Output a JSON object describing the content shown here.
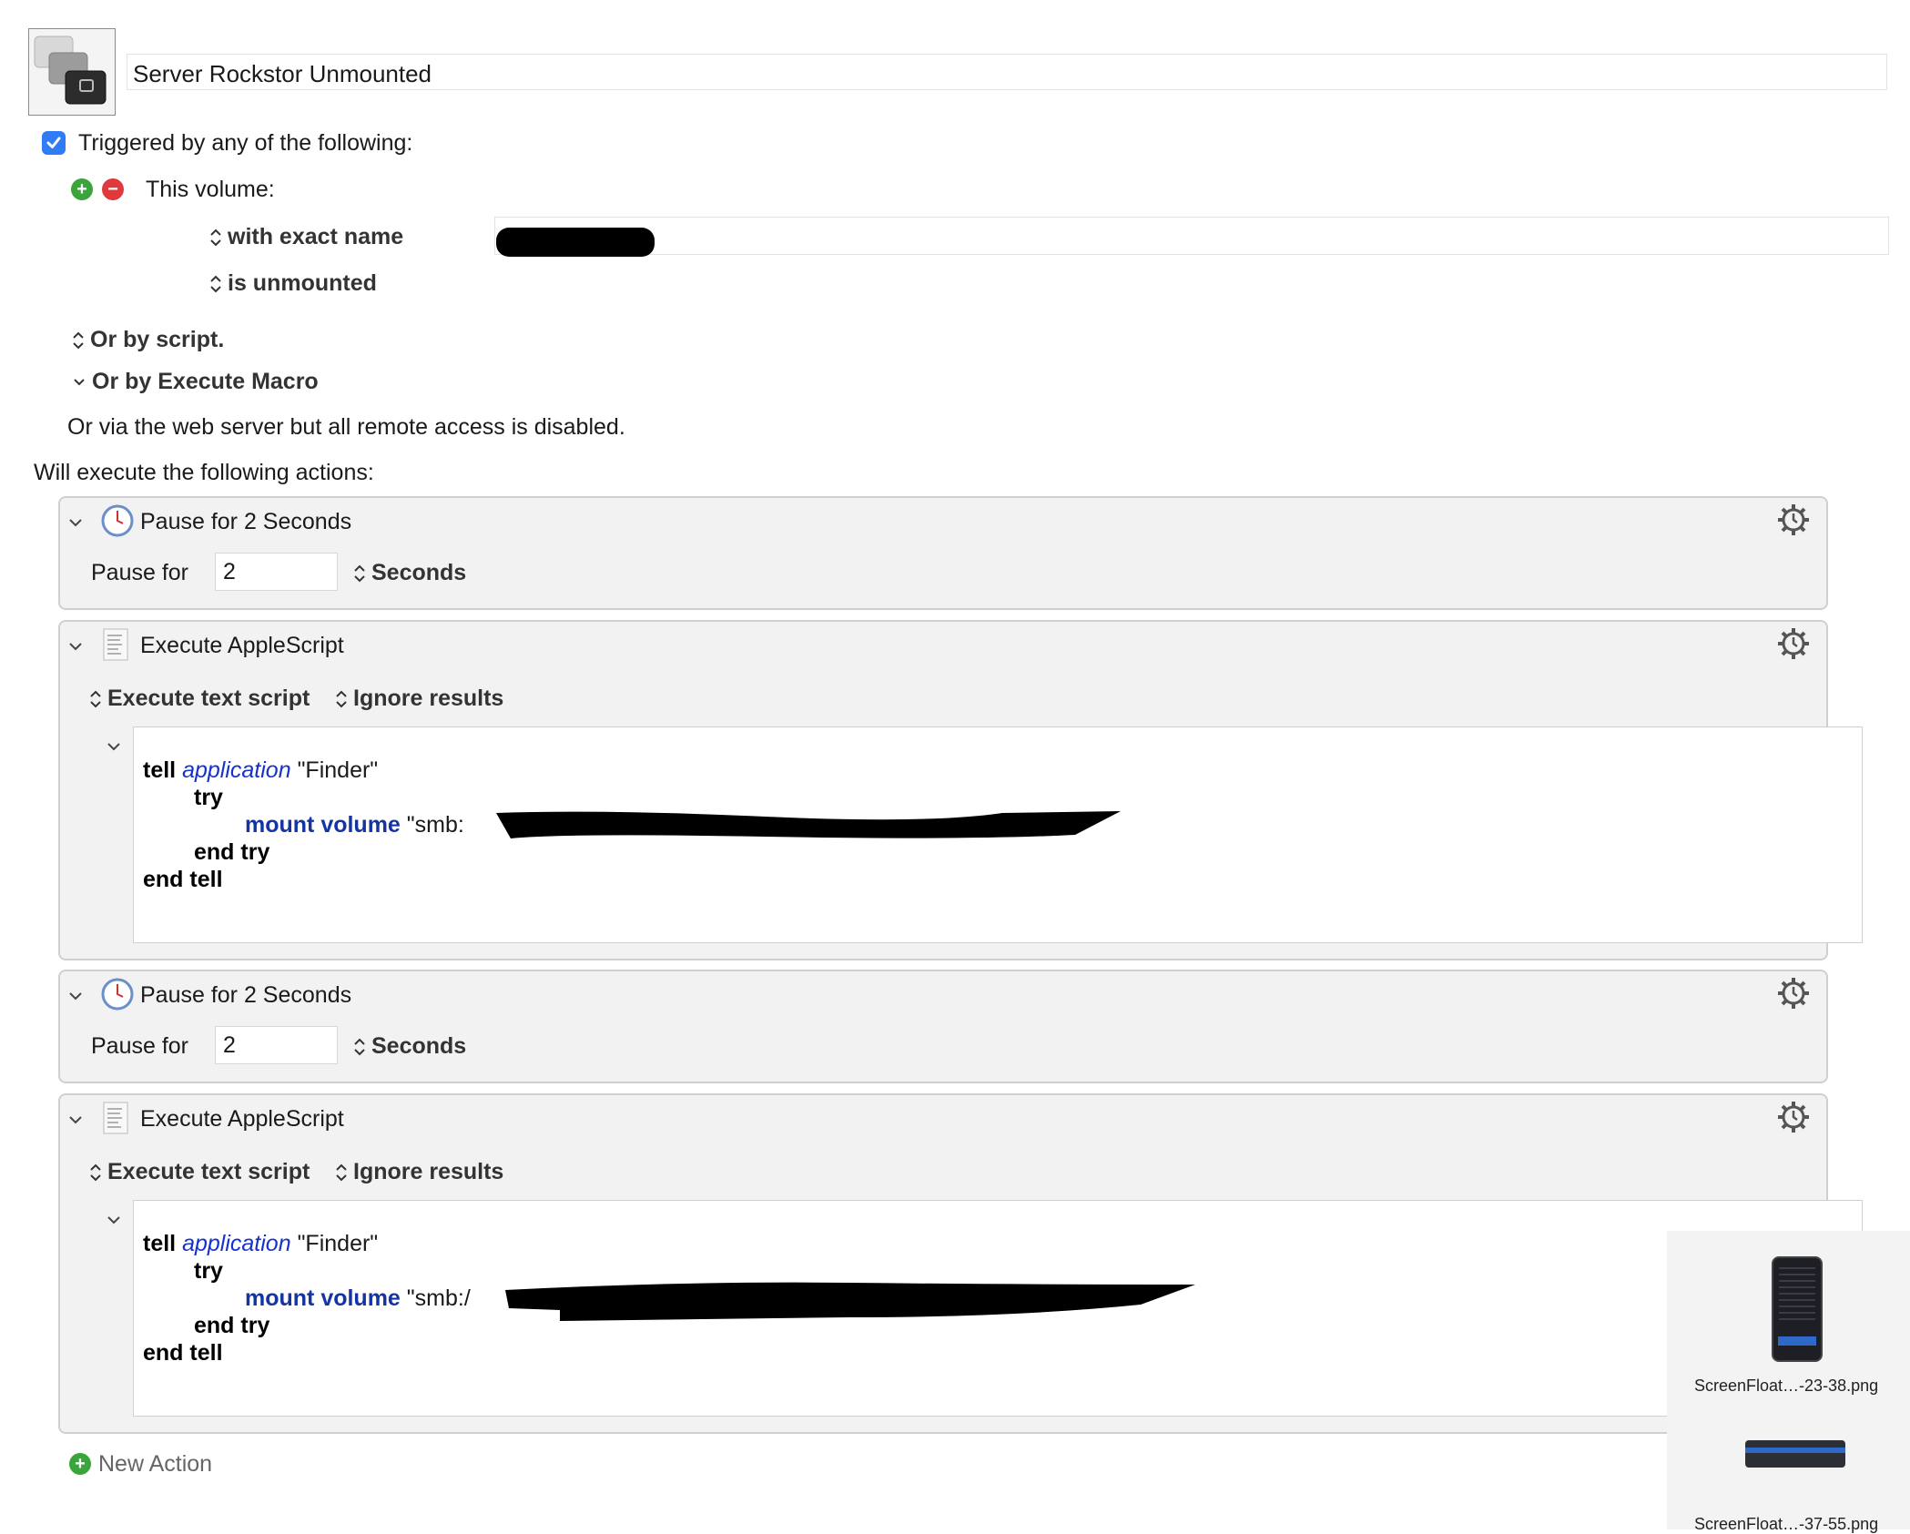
{
  "macro": {
    "name": "Server Rockstor Unmounted"
  },
  "trigger": {
    "checkbox_label": "Triggered by any of the following:",
    "checked": true,
    "volume_label": "This volume:",
    "name_match": "with exact name",
    "state": "is unmounted",
    "or_script": "Or by script.",
    "or_execute_macro": "Or by Execute Macro",
    "web_server_note": "Or via the web server but all remote access is disabled."
  },
  "actions_heading": "Will execute the following actions:",
  "actions": [
    {
      "title": "Pause for 2 Seconds",
      "pause_label": "Pause for",
      "value": "2",
      "unit": "Seconds"
    },
    {
      "title": "Execute AppleScript",
      "mode": "Execute text script",
      "results": "Ignore results",
      "code": {
        "l1_kw": "tell",
        "l1_app": "application",
        "l1_str": "\"Finder\"",
        "l2": "try",
        "l3_cmd": "mount volume",
        "l3_str": "\"smb:",
        "l4": "end try",
        "l5": "end tell"
      }
    },
    {
      "title": "Pause for 2 Seconds",
      "pause_label": "Pause for",
      "value": "2",
      "unit": "Seconds"
    },
    {
      "title": "Execute AppleScript",
      "mode": "Execute text script",
      "results": "Ignore results",
      "code": {
        "l1_kw": "tell",
        "l1_app": "application",
        "l1_str": "\"Finder\"",
        "l2": "try",
        "l3_cmd": "mount volume",
        "l3_str": "\"smb:/",
        "l4": "end try",
        "l5": "end tell"
      }
    }
  ],
  "new_action": "New Action",
  "floating_files": [
    {
      "label": "ScreenFloat…-23-38.png"
    },
    {
      "label": "ScreenFloat…-37-55.png"
    }
  ],
  "colors": {
    "accent": "#2f7cf6",
    "add": "#3aa53a",
    "remove": "#e0393b",
    "keyword_blue": "#1434a4"
  }
}
